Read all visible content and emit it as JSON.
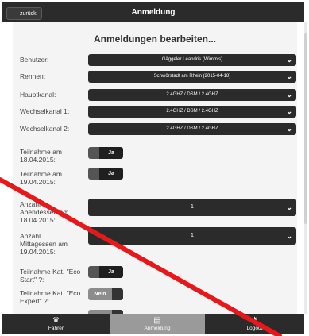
{
  "header": {
    "back_label": "zurück",
    "title": "Anmeldung"
  },
  "page": {
    "heading": "Anmeldungen bearbeiten..."
  },
  "form": {
    "selects": [
      {
        "label": "Benutzer:",
        "value": "Gäggeler Leandris (Wimmis)"
      },
      {
        "label": "Rennen:",
        "value": "Schwörstadt am Rhein (2015-04-18)"
      },
      {
        "label": "Hauptkanal:",
        "value": "2.4GHZ / DSM / 2.4GHZ"
      },
      {
        "label": "Wechselkanal 1:",
        "value": "2.4GHZ / DSM / 2.4GHZ"
      },
      {
        "label": "Wechselkanal 2:",
        "value": "2.4GHZ / DSM / 2.4GHZ"
      }
    ],
    "participation": [
      {
        "label": "Teilnahme am 18.04.2015:",
        "value": "Ja"
      },
      {
        "label": "Teilnahme am 19.04.2015:",
        "value": "Ja"
      }
    ],
    "meals": [
      {
        "label": "Anzahl Abendessen am 18.04.2015:",
        "value": "1"
      },
      {
        "label": "Anzahl Mittagessen am 19.04.2015:",
        "value": "1"
      }
    ],
    "categories": [
      {
        "label": "Teilnahme Kat. \"Eco Start\" ?:",
        "value": "Ja"
      },
      {
        "label": "Teilnahme Kat. \"Eco Expert\" ?:",
        "value": "Nein"
      }
    ]
  },
  "footer": {
    "items": [
      {
        "label": "Fahrer",
        "icon": "person-icon"
      },
      {
        "label": "Anmeldung",
        "icon": "form-icon"
      },
      {
        "label": "Logout",
        "icon": "key-icon"
      }
    ]
  },
  "colors": {
    "bar": "#2b2b2b",
    "content_bg": "#f4f4f4",
    "annotation": "#e3191c"
  }
}
